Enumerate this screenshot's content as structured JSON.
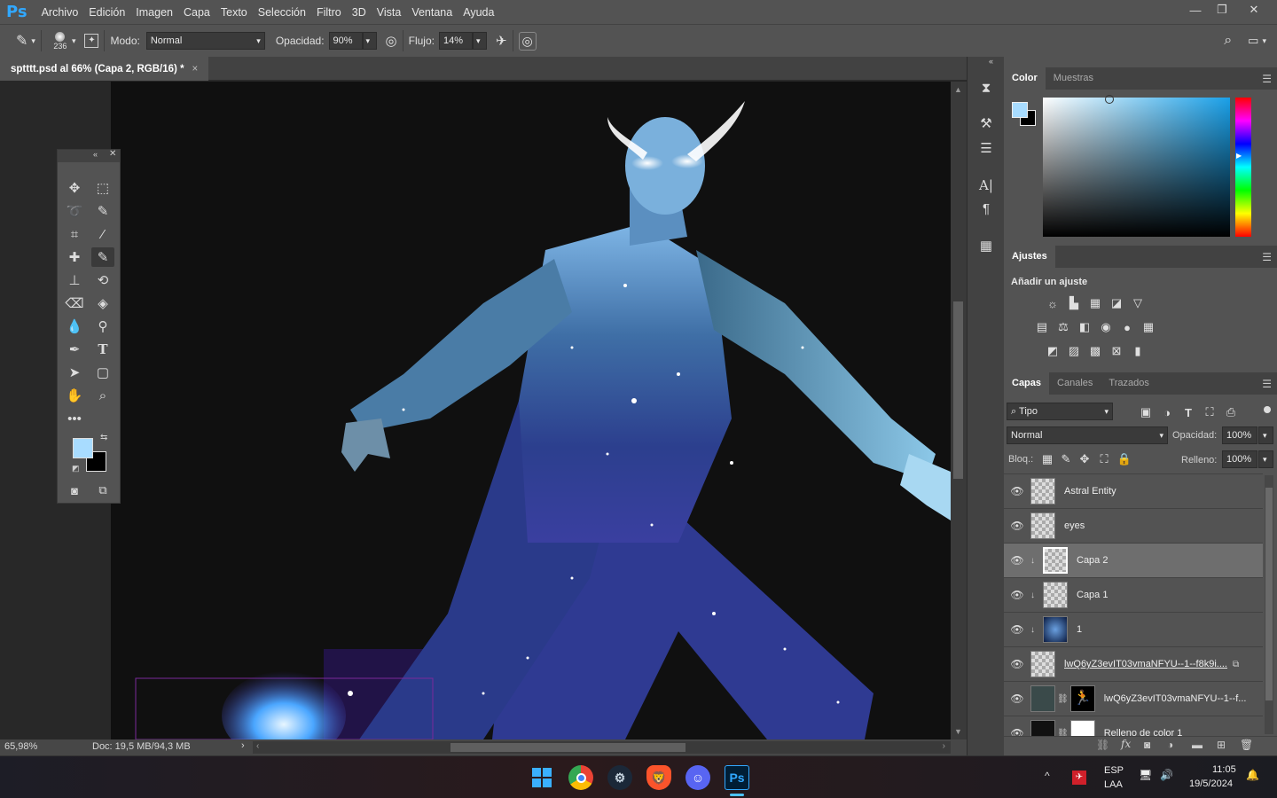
{
  "app": {
    "logo": "Ps"
  },
  "menu": [
    "Archivo",
    "Edición",
    "Imagen",
    "Capa",
    "Texto",
    "Selección",
    "Filtro",
    "3D",
    "Vista",
    "Ventana",
    "Ayuda"
  ],
  "options": {
    "brush_size": "236",
    "mode_label": "Modo:",
    "mode_value": "Normal",
    "opacity_label": "Opacidad:",
    "opacity_value": "90%",
    "flow_label": "Flujo:",
    "flow_value": "14%"
  },
  "document": {
    "tab_title": "sptttt.psd al 66% (Capa 2, RGB/16) *"
  },
  "status": {
    "zoom": "65,98%",
    "doc_info": "Doc: 19,5 MB/94,3 MB"
  },
  "color_panel": {
    "tabs": [
      "Color",
      "Muestras"
    ],
    "foreground": "#a8dcff",
    "background": "#000000"
  },
  "adjust_panel": {
    "tab": "Ajustes",
    "heading": "Añadir un ajuste"
  },
  "layers_panel": {
    "tabs": [
      "Capas",
      "Canales",
      "Trazados"
    ],
    "filter_kind": "Tipo",
    "blend_mode": "Normal",
    "opacity_label": "Opacidad:",
    "opacity_value": "100%",
    "lock_label": "Bloq.:",
    "fill_label": "Relleno:",
    "fill_value": "100%",
    "layers": [
      {
        "name": "Astral Entity"
      },
      {
        "name": "eyes"
      },
      {
        "name": "Capa 2"
      },
      {
        "name": "Capa 1"
      },
      {
        "name": "1"
      },
      {
        "name": "lwQ6yZ3evIT03vmaNFYU--1--f8k9i...."
      },
      {
        "name": "lwQ6yZ3evIT03vmaNFYU--1--f..."
      },
      {
        "name": "Relleno de color 1"
      }
    ]
  },
  "taskbar": {
    "lang1": "ESP",
    "lang2": "LAA",
    "time": "11:05",
    "date": "19/5/2024"
  }
}
